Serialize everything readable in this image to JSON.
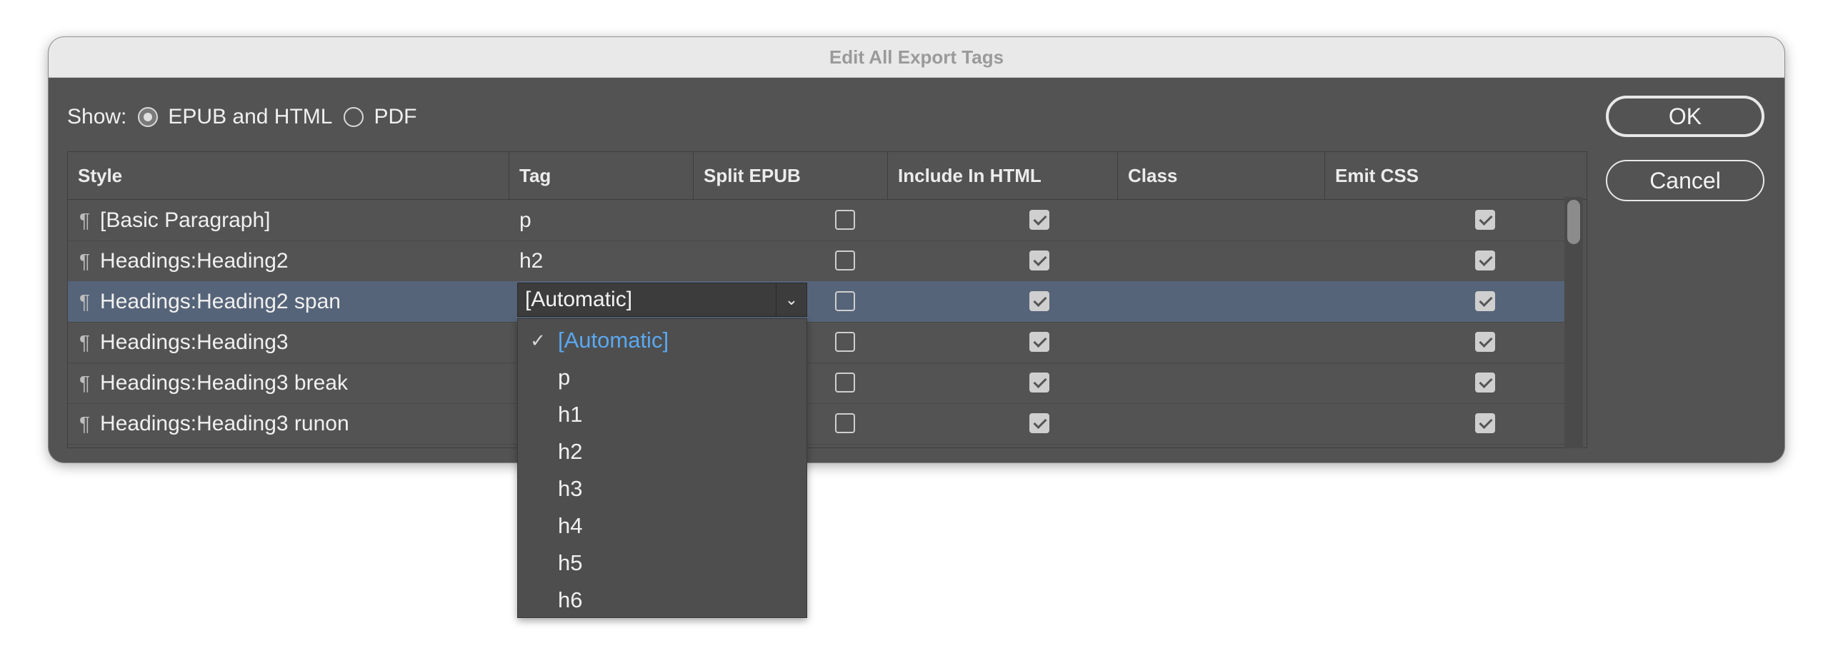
{
  "window": {
    "title": "Edit All Export Tags"
  },
  "show": {
    "label": "Show:",
    "options": [
      {
        "label": "EPUB and HTML",
        "selected": true
      },
      {
        "label": "PDF",
        "selected": false
      }
    ]
  },
  "buttons": {
    "ok": "OK",
    "cancel": "Cancel"
  },
  "table": {
    "headers": [
      "Style",
      "Tag",
      "Split EPUB",
      "Include In HTML",
      "Class",
      "Emit CSS"
    ],
    "rows": [
      {
        "style": "[Basic Paragraph]",
        "tag": "p",
        "split_epub": false,
        "include_html": true,
        "class": "",
        "emit_css": true
      },
      {
        "style": "Headings:Heading2",
        "tag": "h2",
        "split_epub": false,
        "include_html": true,
        "class": "",
        "emit_css": true
      },
      {
        "style": "Headings:Heading2 span",
        "tag": "[Automatic]",
        "split_epub": false,
        "include_html": true,
        "class": "",
        "emit_css": true
      },
      {
        "style": "Headings:Heading3",
        "tag": "",
        "split_epub": false,
        "include_html": true,
        "class": "",
        "emit_css": true
      },
      {
        "style": "Headings:Heading3 break",
        "tag": "",
        "split_epub": false,
        "include_html": true,
        "class": "",
        "emit_css": true
      },
      {
        "style": "Headings:Heading3 runon",
        "tag": "",
        "split_epub": false,
        "include_html": true,
        "class": "",
        "emit_css": true
      }
    ],
    "selected_row": 2
  },
  "style_icon": "paragraph-icon",
  "pilcrow": "¶",
  "tag_dropdown": {
    "current": "[Automatic]",
    "caret": "⌄",
    "check": "✓",
    "options": [
      "[Automatic]",
      "p",
      "h1",
      "h2",
      "h3",
      "h4",
      "h5",
      "h6"
    ]
  }
}
